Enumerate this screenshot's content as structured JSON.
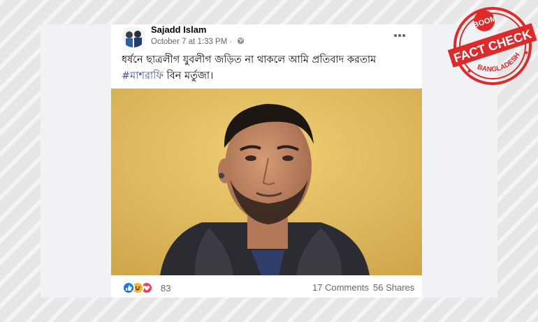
{
  "post": {
    "author": "Sajadd Islam",
    "date": "October 7 at 1:33 PM",
    "separator": "·",
    "text_line1": "ধর্ষনে ছাত্রলীগ যুবলীগ জড়িত না থাকলে আমি প্রতিবাদ করতাম",
    "hashtag": "#মাশরাফি",
    "text_line2_rest": " বিন মর্তুজা।",
    "reaction_count": "83",
    "comments": "17 Comments",
    "shares": "56 Shares"
  },
  "icons": {
    "more": "more-options-icon",
    "privacy": "globe-icon",
    "reactions": [
      "like-icon",
      "haha-icon",
      "love-icon"
    ]
  },
  "stamp": {
    "top": "BOOM",
    "middle": "FACT CHECK",
    "bottom": "BANGLADESH"
  },
  "colors": {
    "stamp_red": "#e02a2a",
    "link_blue": "#385898",
    "like_blue": "#1877f2",
    "haha_yellow": "#f7b928",
    "love_red": "#f33e58"
  }
}
